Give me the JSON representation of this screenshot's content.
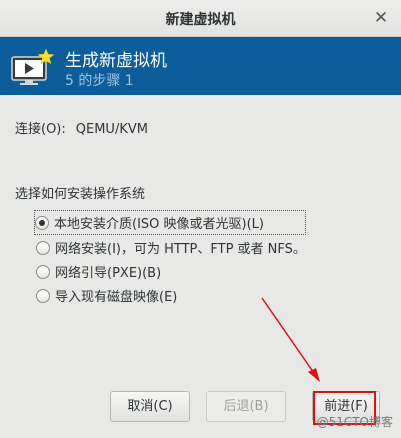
{
  "window": {
    "title": "新建虚拟机",
    "close_glyph": "✕"
  },
  "header": {
    "title": "生成新虚拟机",
    "step": "5 的步骤 1",
    "icon": "monitor-star-icon"
  },
  "connection": {
    "label": "连接(O):",
    "value": "QEMU/KVM"
  },
  "install": {
    "label": "选择如何安装操作系统",
    "options": [
      {
        "label": "本地安装介质(ISO 映像或者光驱)(L)",
        "checked": true
      },
      {
        "label": "网络安装(I)，可为 HTTP、FTP 或者 NFS。",
        "checked": false
      },
      {
        "label": "网络引导(PXE)(B)",
        "checked": false
      },
      {
        "label": "导入现有磁盘映像(E)",
        "checked": false
      }
    ]
  },
  "buttons": {
    "cancel": "取消(C)",
    "back": "后退(B)",
    "forward": "前进(F)"
  },
  "watermark": "@51CTO博客",
  "colors": {
    "header_bg": "#0c5d99",
    "annotation": "#e01010"
  }
}
